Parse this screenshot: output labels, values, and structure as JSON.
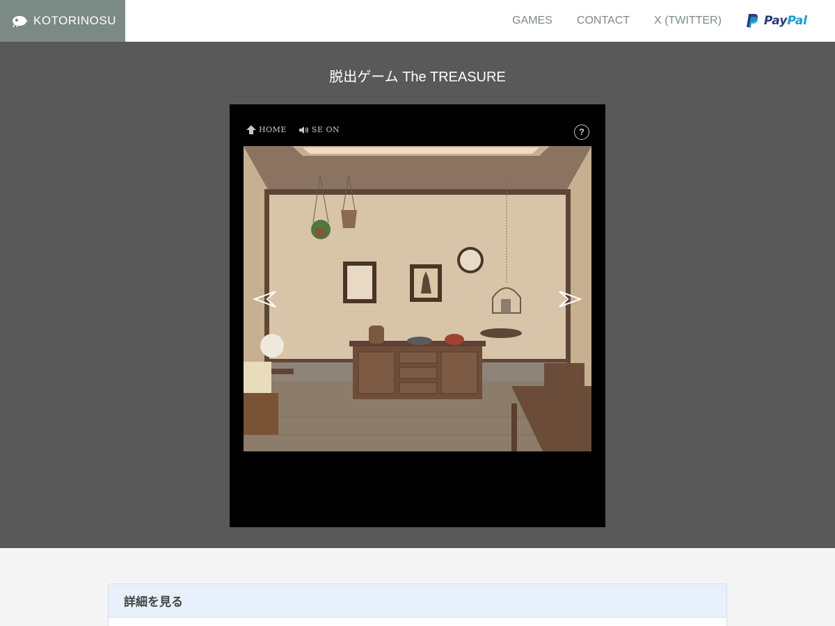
{
  "header": {
    "logo_text": "KOTORINOSU",
    "nav": [
      "GAMES",
      "CONTACT",
      "X (TWITTER)"
    ],
    "paypal_part1": "Pay",
    "paypal_part2": "Pal"
  },
  "game": {
    "title": "脱出ゲーム The TREASURE",
    "home_label": "HOME",
    "sound_label": "SE ON",
    "help_label": "?"
  },
  "details": {
    "label": "詳細を見る"
  },
  "colors": {
    "logo_bg": "#7c8a85",
    "stage_bg": "#595959",
    "details_head_bg": "#e8f1fb"
  },
  "icons": [
    "bird-logo-icon",
    "paypal-icon",
    "home-arrow-icon",
    "speaker-icon",
    "help-icon",
    "left-arrow-icon",
    "right-arrow-icon"
  ]
}
